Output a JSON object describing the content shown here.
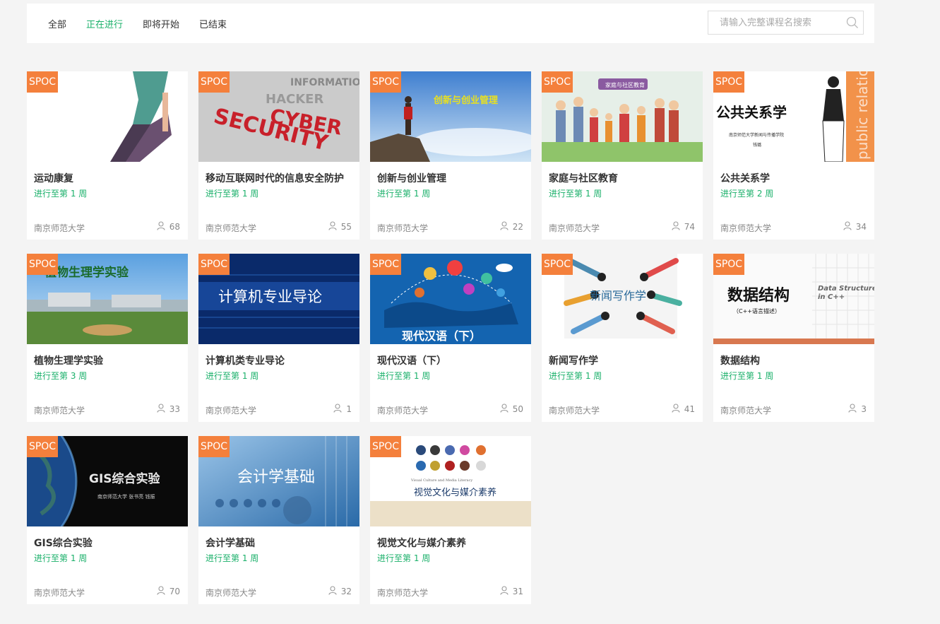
{
  "tabs": [
    {
      "label": "全部"
    },
    {
      "label": "正在进行"
    },
    {
      "label": "即将开始"
    },
    {
      "label": "已结束"
    }
  ],
  "active_tab": "正在进行",
  "search": {
    "placeholder": "请输入完整课程名搜索",
    "value": ""
  },
  "accent_color": "#1ab06a",
  "badge_color": "#f4803c",
  "courses": [
    {
      "badge": "SPOC",
      "title": "运动康复",
      "progress": "进行至第 1 周",
      "school": "南京师范大学",
      "count": "68"
    },
    {
      "badge": "SPOC",
      "title": "移动互联网时代的信息安全防护",
      "progress": "进行至第 1 周",
      "school": "南京师范大学",
      "count": "55",
      "thumb_text": [
        "CYBER",
        "SECURITY",
        "HACKER",
        "INFORMATION"
      ]
    },
    {
      "badge": "SPOC",
      "title": "创新与创业管理",
      "progress": "进行至第 1 周",
      "school": "南京师范大学",
      "count": "22",
      "thumb_text": [
        "创新与创业管理"
      ]
    },
    {
      "badge": "SPOC",
      "title": "家庭与社区教育",
      "progress": "进行至第 1 周",
      "school": "南京师范大学",
      "count": "74",
      "thumb_text": [
        "家庭与社区教育"
      ]
    },
    {
      "badge": "SPOC",
      "title": "公共关系学",
      "progress": "进行至第 2 周",
      "school": "南京师范大学",
      "count": "34",
      "thumb_text": [
        "公共关系学",
        "南京师范大学新闻与传播学院",
        "钱璐",
        "public relation"
      ]
    },
    {
      "badge": "SPOC",
      "title": "植物生理学实验",
      "progress": "进行至第 3 周",
      "school": "南京师范大学",
      "count": "33",
      "thumb_text": [
        "植物生理学实验"
      ]
    },
    {
      "badge": "SPOC",
      "title": "计算机类专业导论",
      "progress": "进行至第 1 周",
      "school": "南京师范大学",
      "count": "1",
      "thumb_text": [
        "计算机专业导论"
      ]
    },
    {
      "badge": "SPOC",
      "title": "现代汉语（下）",
      "progress": "进行至第 1 周",
      "school": "南京师范大学",
      "count": "50",
      "thumb_text": [
        "现代汉语（下）"
      ]
    },
    {
      "badge": "SPOC",
      "title": "新闻写作学",
      "progress": "进行至第 1 周",
      "school": "南京师范大学",
      "count": "41",
      "thumb_text": [
        "新闻写作学"
      ]
    },
    {
      "badge": "SPOC",
      "title": "数据结构",
      "progress": "进行至第 1 周",
      "school": "南京师范大学",
      "count": "3",
      "thumb_text": [
        "数据结构",
        "（C++语言描述）",
        "Data Structures",
        "in C++"
      ]
    },
    {
      "badge": "SPOC",
      "title": "GIS综合实验",
      "progress": "进行至第 1 周",
      "school": "南京师范大学",
      "count": "70",
      "thumb_text": [
        "GIS综合实验",
        "南京师范大学 张书亮 钱振"
      ]
    },
    {
      "badge": "SPOC",
      "title": "会计学基础",
      "progress": "进行至第 1 周",
      "school": "南京师范大学",
      "count": "32",
      "thumb_text": [
        "会计学基础"
      ]
    },
    {
      "badge": "SPOC",
      "title": "视觉文化与媒介素养",
      "progress": "进行至第 1 周",
      "school": "南京师范大学",
      "count": "31",
      "thumb_text": [
        "视觉文化与媒介素养",
        "Visual Culture and Media Literacy"
      ]
    }
  ]
}
